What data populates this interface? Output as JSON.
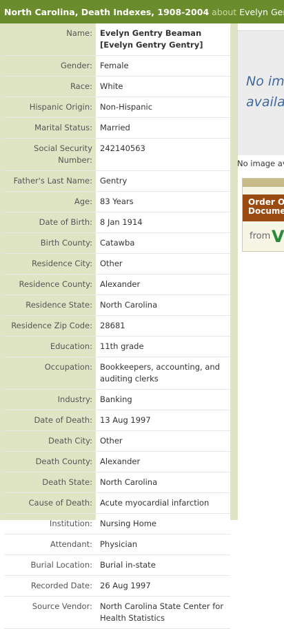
{
  "header": {
    "collection": "North Carolina, Death Indexes, 1908-2004",
    "about": "about",
    "person": "Evelyn Gentry Beaman"
  },
  "record": {
    "name_label": "Name:",
    "name_line1": "Evelyn Gentry Beaman",
    "name_line2": "[Evelyn Gentry Gentry]",
    "fields": [
      {
        "label": "Gender:",
        "value": "Female"
      },
      {
        "label": "Race:",
        "value": "White"
      },
      {
        "label": "Hispanic Origin:",
        "value": "Non-Hispanic"
      },
      {
        "label": "Marital Status:",
        "value": "Married"
      },
      {
        "label": "Social Security Number:",
        "value": "242140563"
      },
      {
        "label": "Father's Last Name:",
        "value": "Gentry"
      },
      {
        "label": "Age:",
        "value": "83 Years"
      },
      {
        "label": "Date of Birth:",
        "value": "8 Jan 1914"
      },
      {
        "label": "Birth County:",
        "value": "Catawba"
      },
      {
        "label": "Residence City:",
        "value": "Other"
      },
      {
        "label": "Residence County:",
        "value": "Alexander"
      },
      {
        "label": "Residence State:",
        "value": "North Carolina"
      },
      {
        "label": "Residence Zip Code:",
        "value": "28681"
      },
      {
        "label": "Education:",
        "value": "11th grade"
      },
      {
        "label": "Occupation:",
        "value": "Bookkeepers, accounting, and auditing clerks"
      },
      {
        "label": "Industry:",
        "value": "Banking"
      },
      {
        "label": "Date of Death:",
        "value": "13 Aug 1997"
      },
      {
        "label": "Death City:",
        "value": "Other"
      },
      {
        "label": "Death County:",
        "value": "Alexander"
      },
      {
        "label": "Death State:",
        "value": "North Carolina"
      },
      {
        "label": "Cause of Death:",
        "value": "Acute myocardial infarction"
      },
      {
        "label": "Institution:",
        "value": "Nursing Home"
      },
      {
        "label": "Attendant:",
        "value": "Physician"
      },
      {
        "label": "Burial Location:",
        "value": "Burial in-state"
      },
      {
        "label": "Recorded Date:",
        "value": "26 Aug 1997"
      },
      {
        "label": "Source Vendor:",
        "value": "North Carolina State Center for Health Statistics"
      }
    ]
  },
  "image_panel": {
    "placeholder_line1": "No ima",
    "placeholder_line2": "availa",
    "caption": "No image av"
  },
  "order_box": {
    "button_line1": "Order Or",
    "button_line2": "Documen",
    "from": "from",
    "vital": "Vit"
  },
  "colors": {
    "header_bg": "#6a8c2c",
    "panel_bg": "#dfe5c4",
    "order_button": "#9a4b12"
  }
}
